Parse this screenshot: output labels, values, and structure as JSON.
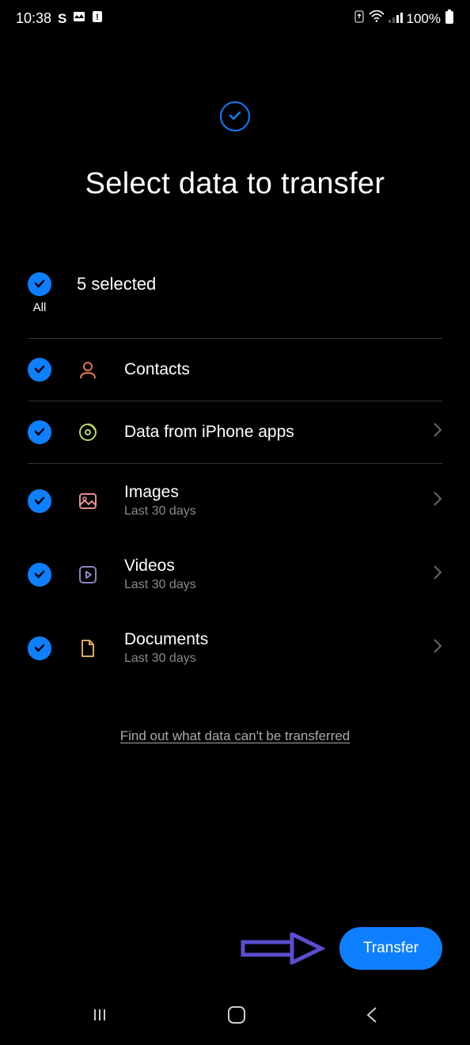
{
  "status_bar": {
    "time": "10:38",
    "battery": "100%"
  },
  "header": {
    "title": "Select data to transfer"
  },
  "selection": {
    "all_label": "All",
    "count_text": "5 selected"
  },
  "items": [
    {
      "title": "Contacts",
      "sub": null,
      "chevron": false,
      "icon": "contacts",
      "icon_color": "#e07850"
    },
    {
      "title": "Data from iPhone apps",
      "sub": null,
      "chevron": true,
      "icon": "appdata",
      "icon_color": "#b8d468"
    },
    {
      "title": "Images",
      "sub": "Last 30 days",
      "chevron": true,
      "icon": "images",
      "icon_color": "#e09090"
    },
    {
      "title": "Videos",
      "sub": "Last 30 days",
      "chevron": true,
      "icon": "videos",
      "icon_color": "#9080c0"
    },
    {
      "title": "Documents",
      "sub": "Last 30 days",
      "chevron": true,
      "icon": "documents",
      "icon_color": "#d8a858"
    }
  ],
  "find_link": "Find out what data can't be transferred",
  "transfer_button": "Transfer"
}
